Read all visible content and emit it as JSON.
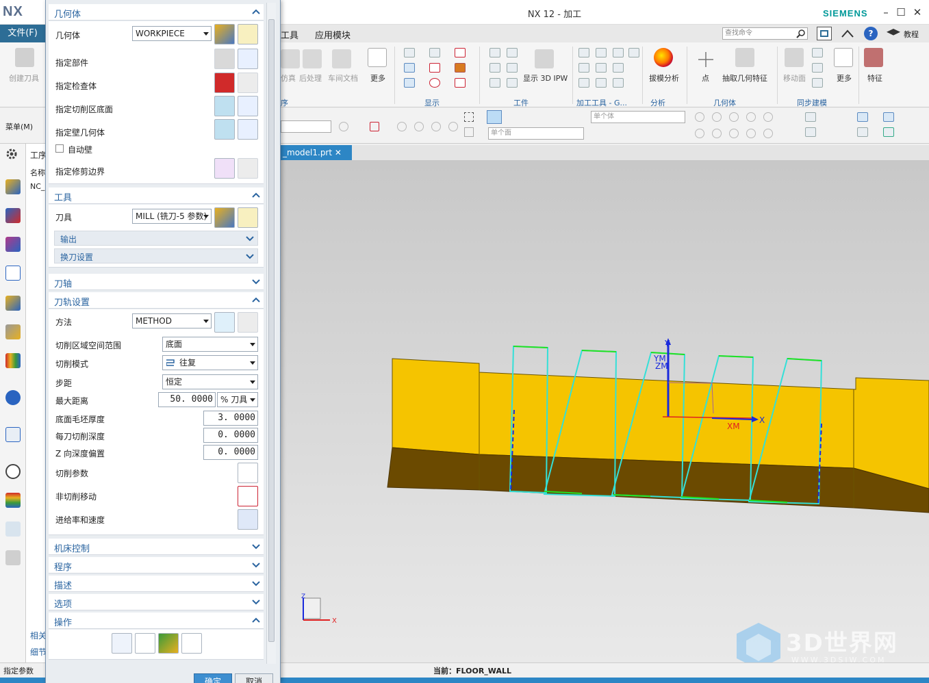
{
  "app": {
    "logo": "NX",
    "title": "NX 12 - 加工",
    "brand": "SIEMENS"
  },
  "menubar": {
    "file": "文件(F)",
    "items": [
      "工具",
      "应用模块"
    ],
    "search_placeholder": "查找命令",
    "tutorial": "教程"
  },
  "ribbon": {
    "create_tool": "创建刀具",
    "dim_labels": [
      "仿真",
      "后处理",
      "车间文档"
    ],
    "more1": "更多",
    "show_ipw": "显示 3D IPW",
    "draft_analysis": "拔模分析",
    "point": "点",
    "extract_geometry": "抽取几何特征",
    "move_face": "移动面",
    "more2": "更多",
    "feature": "特征",
    "groups": [
      "序",
      "显示",
      "工件",
      "加工工具 - G...",
      "分析",
      "几何体",
      "同步建模"
    ]
  },
  "toolbar2": {
    "menu": "菜单(M)",
    "filter_body": "单个体",
    "filter_face": "单个面"
  },
  "navigator": {
    "header_tab": "工序",
    "column_name": "名称",
    "root": "NC_",
    "bottom_tabs": [
      "相关",
      "细节"
    ]
  },
  "file_tab": "_model1.prt",
  "viewport": {
    "axis_labels": {
      "x": "X",
      "y": "Y",
      "zm": "ZM",
      "ym": "YM",
      "xm": "XM"
    },
    "triad": {
      "z": "Z",
      "x": "X"
    }
  },
  "watermark": {
    "title": "3D世界网",
    "url": "WWW.3DSJW.COM"
  },
  "status": {
    "left": "指定参数",
    "current": "当前：FLOOR_WALL"
  },
  "dialog": {
    "geometry": {
      "title": "几何体",
      "geometry_label": "几何体",
      "geometry_value": "WORKPIECE",
      "rows": [
        "指定部件",
        "指定检查体",
        "指定切削区底面",
        "指定壁几何体"
      ],
      "auto_wall": "自动壁",
      "trim_boundary": "指定修剪边界"
    },
    "tool": {
      "title": "工具",
      "tool_label": "刀具",
      "tool_value": "MILL (铣刀-5 参数)",
      "output": "输出",
      "tool_change": "换刀设置"
    },
    "tool_axis": "刀轴",
    "path": {
      "title": "刀轨设置",
      "method_label": "方法",
      "method_value": "METHOD",
      "cut_region_label": "切削区域空间范围",
      "cut_region_value": "底面",
      "cut_pattern_label": "切削模式",
      "cut_pattern_value": "往复",
      "stepover_label": "步距",
      "stepover_value": "恒定",
      "max_dist_label": "最大距离",
      "max_dist_value": "50. 0000",
      "max_dist_unit": "% 刀具",
      "floor_stock_label": "底面毛坯厚度",
      "floor_stock_value": "3. 0000",
      "depth_per_cut_label": "每刀切削深度",
      "depth_per_cut_value": "0. 0000",
      "z_offset_label": "Z 向深度偏置",
      "z_offset_value": "0. 0000",
      "cut_params": "切削参数",
      "non_cut_moves": "非切削移动",
      "feeds_speeds": "进给率和速度"
    },
    "collapsed": [
      "机床控制",
      "程序",
      "描述",
      "选项"
    ],
    "actions_title": "操作",
    "ok": "确定",
    "cancel": "取消"
  }
}
